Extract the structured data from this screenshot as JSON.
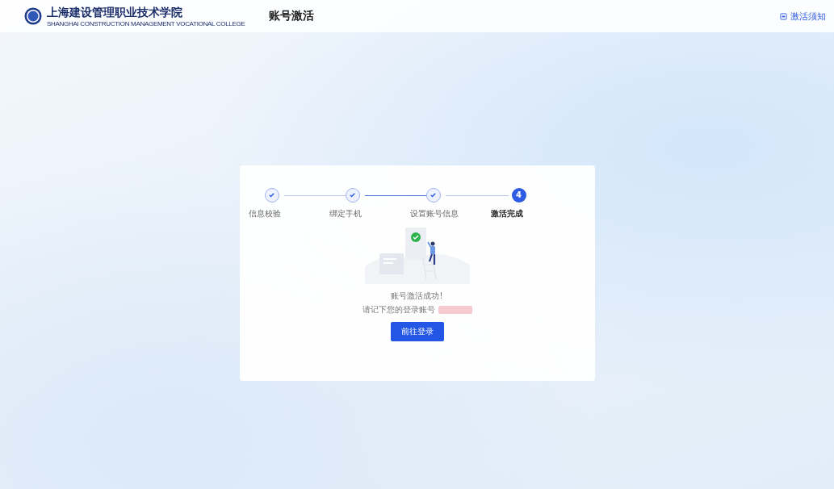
{
  "header": {
    "school_name": "上海建设管理职业技术学院",
    "school_name_en": "SHANGHAI CONSTRUCTION MANAGEMENT VOCATIONAL COLLEGE",
    "page_title": "账号激活",
    "notice_link": "激活须知"
  },
  "steps": [
    {
      "label": "信息校验",
      "done": true,
      "selected": false
    },
    {
      "label": "绑定手机",
      "done": true,
      "selected": false
    },
    {
      "label": "设置账号信息",
      "done": true,
      "selected": false
    },
    {
      "label": "激活完成",
      "number": "4",
      "done": false,
      "selected": true
    }
  ],
  "result": {
    "message": "账号激活成功!",
    "account_prompt": "请记下您的登录账号",
    "account_redacted": true,
    "button": "前往登录"
  }
}
